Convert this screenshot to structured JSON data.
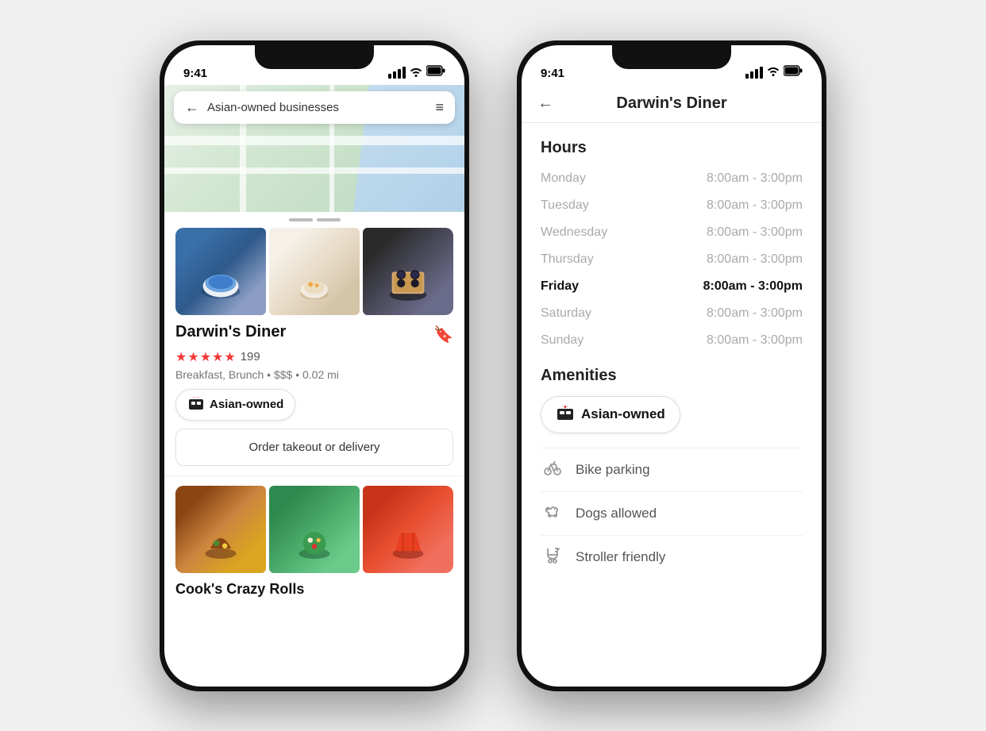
{
  "app": {
    "time": "9:41"
  },
  "left_phone": {
    "search_bar": {
      "text": "Asian-owned businesses",
      "back_label": "←",
      "list_icon": "≡"
    },
    "restaurant1": {
      "name": "Darwin's Diner",
      "stars": 4.5,
      "review_count": "199",
      "meta": "Breakfast, Brunch  •  $$$  •  0.02 mi",
      "badge": "Asian-owned",
      "order_button": "Order takeout or delivery"
    },
    "restaurant2": {
      "name": "Cook's Crazy Rolls"
    }
  },
  "right_phone": {
    "header": {
      "back_label": "←",
      "title": "Darwin's Diner"
    },
    "hours_section": {
      "title": "Hours",
      "rows": [
        {
          "day": "Monday",
          "time": "8:00am - 3:00pm",
          "active": false
        },
        {
          "day": "Tuesday",
          "time": "8:00am - 3:00pm",
          "active": false
        },
        {
          "day": "Wednesday",
          "time": "8:00am - 3:00pm",
          "active": false
        },
        {
          "day": "Thursday",
          "time": "8:00am - 3:00pm",
          "active": false
        },
        {
          "day": "Friday",
          "time": "8:00am - 3:00pm",
          "active": true
        },
        {
          "day": "Saturday",
          "time": "8:00am - 3:00pm",
          "active": false
        },
        {
          "day": "Sunday",
          "time": "8:00am - 3:00pm",
          "active": false
        }
      ]
    },
    "amenities_section": {
      "title": "Amenities",
      "badge": "Asian-owned",
      "items": [
        {
          "label": "Bike parking",
          "icon": "bike"
        },
        {
          "label": "Dogs allowed",
          "icon": "dog"
        },
        {
          "label": "Stroller friendly",
          "icon": "stroller"
        }
      ]
    }
  }
}
